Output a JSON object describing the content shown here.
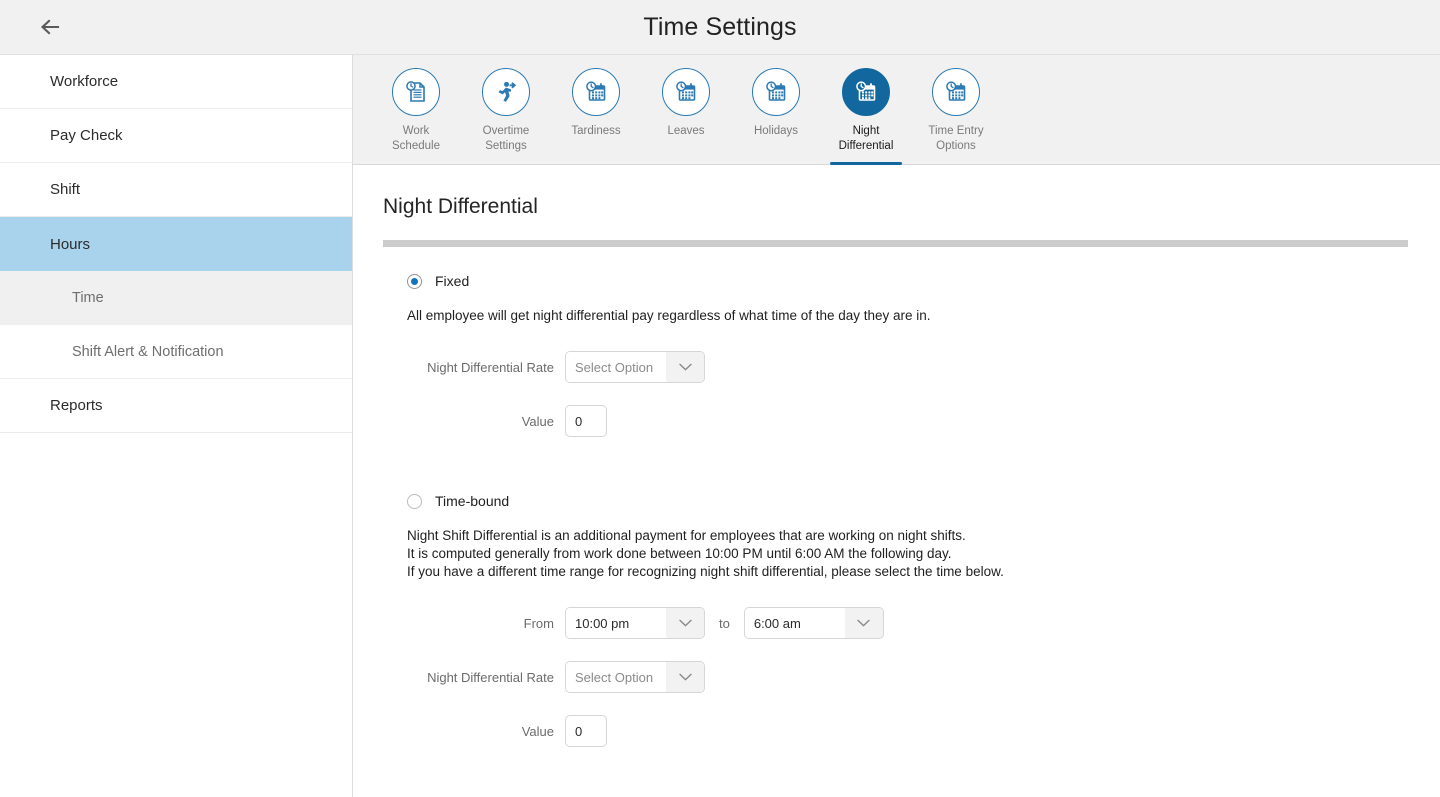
{
  "header": {
    "title": "Time Settings",
    "back_icon": "arrow-left-icon"
  },
  "sidebar": {
    "items": [
      {
        "label": "Workforce",
        "type": "nav",
        "active": false
      },
      {
        "label": "Pay Check",
        "type": "nav",
        "active": false
      },
      {
        "label": "Shift",
        "type": "nav",
        "active": false
      },
      {
        "label": "Hours",
        "type": "nav",
        "active": true
      },
      {
        "label": "Time",
        "type": "sub",
        "selected": true
      },
      {
        "label": "Shift Alert & Notification",
        "type": "sub",
        "selected": false
      },
      {
        "label": "Reports",
        "type": "nav",
        "active": false
      }
    ]
  },
  "tabs": [
    {
      "label": "Work\nSchedule",
      "icon": "document-clock-icon",
      "active": false
    },
    {
      "label": "Overtime\nSettings",
      "icon": "running-person-arrow-icon",
      "active": false
    },
    {
      "label": "Tardiness",
      "icon": "calendar-clock-icon",
      "active": false
    },
    {
      "label": "Leaves",
      "icon": "calendar-clock-icon",
      "active": false
    },
    {
      "label": "Holidays",
      "icon": "calendar-clock-icon",
      "active": false
    },
    {
      "label": "Night\nDifferential",
      "icon": "calendar-clock-icon",
      "active": true
    },
    {
      "label": "Time Entry\nOptions",
      "icon": "calendar-clock-icon",
      "active": false
    }
  ],
  "main": {
    "page_title": "Night Differential",
    "fixed": {
      "radio_label": "Fixed",
      "selected": true,
      "description": "All employee will get night differential pay regardless of what time of the day they are in.",
      "rate_label": "Night Differential Rate",
      "rate_value": "Select Option",
      "value_label": "Value",
      "value_value": "0"
    },
    "timebound": {
      "radio_label": "Time-bound",
      "selected": false,
      "description_line1": "Night Shift Differential is an additional payment for employees that are working on night shifts.",
      "description_line2": "It is computed generally from work done between 10:00 PM until 6:00 AM the following day.",
      "description_line3": "If you have a different time range for recognizing night shift differential, please select the time below.",
      "from_label": "From",
      "from_value": "10:00 pm",
      "to_label": "to",
      "to_value": "6:00 am",
      "rate_label": "Night Differential Rate",
      "rate_value": "Select Option",
      "value_label": "Value",
      "value_value": "0"
    }
  },
  "colors": {
    "accent_blue": "#12679f",
    "icon_blue": "#2b7ab3",
    "sidebar_active": "#a9d2ec",
    "radio_blue": "#1472b8",
    "rule_grey": "#cccccc"
  }
}
